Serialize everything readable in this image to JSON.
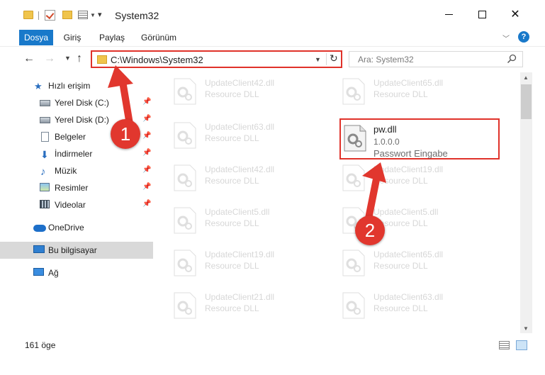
{
  "window": {
    "title": "System32",
    "minimize_label": "",
    "maximize_label": "",
    "close_label": "✕"
  },
  "ribbon": {
    "tabs": [
      "Dosya",
      "Giriş",
      "Paylaş",
      "Görünüm"
    ],
    "help": "?"
  },
  "nav": {
    "address": "C:\\Windows\\System32",
    "search_placeholder": "Ara: System32"
  },
  "sidebar": {
    "items": [
      {
        "label": "Hızlı erişim",
        "icon": "star-icon",
        "pinned": false
      },
      {
        "label": "Yerel Disk (C:)",
        "icon": "disk-icon",
        "pinned": true
      },
      {
        "label": "Yerel Disk (D:)",
        "icon": "disk-icon",
        "pinned": true
      },
      {
        "label": "Belgeler",
        "icon": "document-icon",
        "pinned": true
      },
      {
        "label": "İndirmeler",
        "icon": "download-icon",
        "pinned": true
      },
      {
        "label": "Müzik",
        "icon": "music-icon",
        "pinned": true
      },
      {
        "label": "Resimler",
        "icon": "pictures-icon",
        "pinned": true
      },
      {
        "label": "Videolar",
        "icon": "video-icon",
        "pinned": true
      },
      {
        "label": "OneDrive",
        "icon": "onedrive-icon",
        "pinned": false
      },
      {
        "label": "Bu bilgisayar",
        "icon": "computer-icon",
        "pinned": false,
        "selected": true
      },
      {
        "label": "Ağ",
        "icon": "network-icon",
        "pinned": false
      }
    ]
  },
  "files": [
    {
      "name": "UpdateClient42.dll",
      "desc": "Resource DLL"
    },
    {
      "name": "UpdateClient65.dll",
      "desc": "Resource DLL"
    },
    {
      "name": "UpdateClient63.dll",
      "desc": "Resource DLL"
    },
    {
      "name": "pw.dll",
      "version": "1.0.0.0",
      "desc": "Passwort Eingabe",
      "highlighted": true
    },
    {
      "name": "UpdateClient42.dll",
      "desc": "Resource DLL"
    },
    {
      "name": "UpdateClient19.dll",
      "desc": "Resource DLL"
    },
    {
      "name": "UpdateClient5.dll",
      "desc": "Resource DLL"
    },
    {
      "name": "UpdateClient5.dll",
      "desc": "Resource DLL"
    },
    {
      "name": "UpdateClient19.dll",
      "desc": "Resource DLL"
    },
    {
      "name": "UpdateClient65.dll",
      "desc": "Resource DLL"
    },
    {
      "name": "UpdateClient21.dll",
      "desc": "Resource DLL"
    },
    {
      "name": "UpdateClient63.dll",
      "desc": "Resource DLL"
    }
  ],
  "status": {
    "item_count": "161 öge"
  },
  "annotations": {
    "step1": "1",
    "step2": "2"
  },
  "colors": {
    "accent": "#1979ca",
    "highlight_border": "#e0322a",
    "callout": "#e1372e",
    "selected_bg": "#d9d9d9"
  }
}
